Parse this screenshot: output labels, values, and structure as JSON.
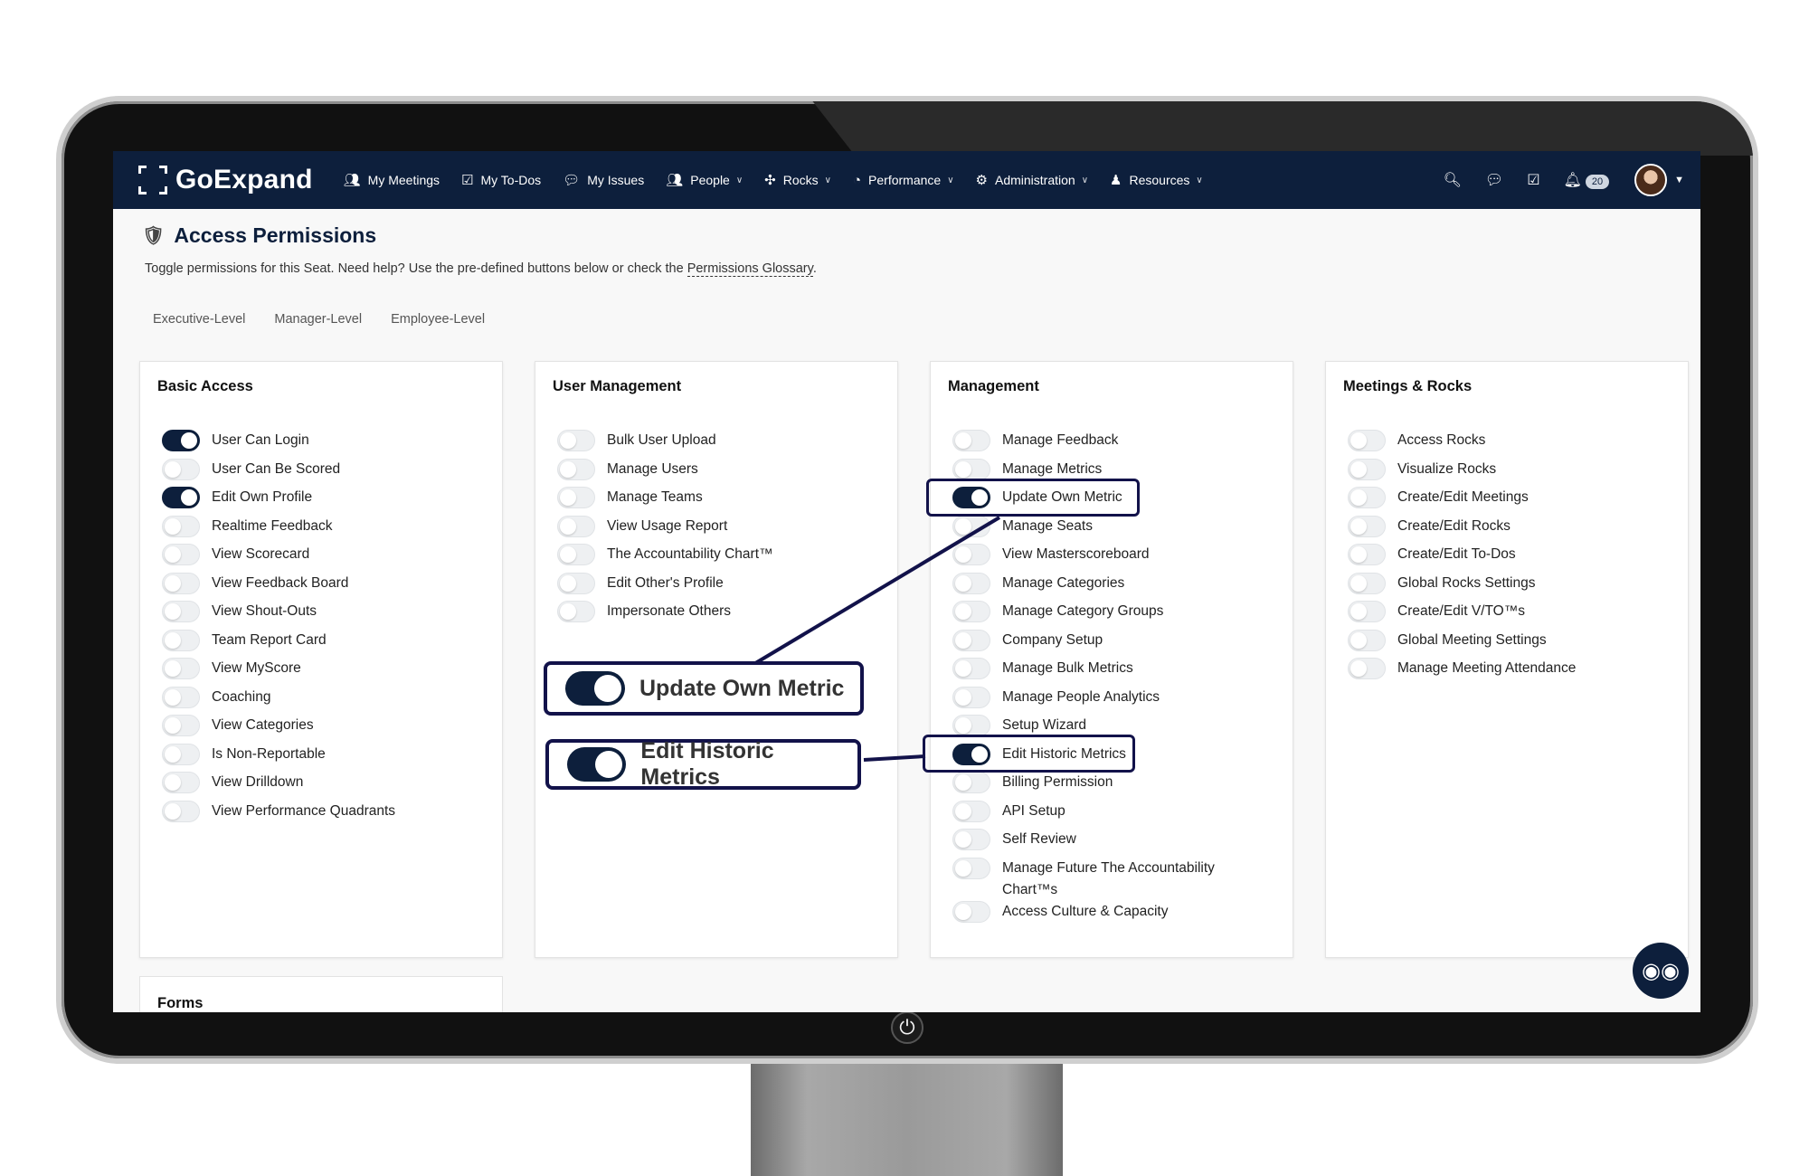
{
  "nav": {
    "logo": "GoExpand",
    "items": [
      {
        "label": "My Meetings",
        "icon": "meetings-icon",
        "dropdown": false
      },
      {
        "label": "My To-Dos",
        "icon": "checkbox-icon",
        "dropdown": false
      },
      {
        "label": "My Issues",
        "icon": "chat-icon",
        "dropdown": false
      },
      {
        "label": "People",
        "icon": "people-icon",
        "dropdown": true
      },
      {
        "label": "Rocks",
        "icon": "rocks-icon",
        "dropdown": true
      },
      {
        "label": "Performance",
        "icon": "gauge-icon",
        "dropdown": true
      },
      {
        "label": "Administration",
        "icon": "gear-icon",
        "dropdown": true
      },
      {
        "label": "Resources",
        "icon": "resources-icon",
        "dropdown": true
      }
    ],
    "notification_count": "20"
  },
  "page": {
    "title": "Access Permissions",
    "description_pre": "Toggle permissions for this Seat. Need help? Use the pre-defined buttons below or check the ",
    "glossary_link": "Permissions Glossary",
    "description_post": ".",
    "levels": [
      "Executive-Level",
      "Manager-Level",
      "Employee-Level"
    ]
  },
  "cards": [
    {
      "title": "Basic Access",
      "permissions": [
        {
          "label": "User Can Login",
          "on": true
        },
        {
          "label": "User Can Be Scored",
          "on": false
        },
        {
          "label": "Edit Own Profile",
          "on": true
        },
        {
          "label": "Realtime Feedback",
          "on": false
        },
        {
          "label": "View Scorecard",
          "on": false
        },
        {
          "label": "View Feedback Board",
          "on": false
        },
        {
          "label": "View Shout-Outs",
          "on": false
        },
        {
          "label": "Team Report Card",
          "on": false
        },
        {
          "label": "View MyScore",
          "on": false
        },
        {
          "label": "Coaching",
          "on": false
        },
        {
          "label": "View Categories",
          "on": false
        },
        {
          "label": "Is Non-Reportable",
          "on": false
        },
        {
          "label": "View Drilldown",
          "on": false
        },
        {
          "label": "View Performance Quadrants",
          "on": false
        }
      ]
    },
    {
      "title": "User Management",
      "permissions": [
        {
          "label": "Bulk User Upload",
          "on": false
        },
        {
          "label": "Manage Users",
          "on": false
        },
        {
          "label": "Manage Teams",
          "on": false
        },
        {
          "label": "View Usage Report",
          "on": false
        },
        {
          "label": "The Accountability Chart™",
          "on": false
        },
        {
          "label": "Edit Other's Profile",
          "on": false
        },
        {
          "label": "Impersonate Others",
          "on": false
        }
      ]
    },
    {
      "title": "Management",
      "permissions": [
        {
          "label": "Manage Feedback",
          "on": false
        },
        {
          "label": "Manage Metrics",
          "on": false
        },
        {
          "label": "Update Own Metric",
          "on": true
        },
        {
          "label": "Manage Seats",
          "on": false
        },
        {
          "label": "View Masterscoreboard",
          "on": false
        },
        {
          "label": "Manage Categories",
          "on": false
        },
        {
          "label": "Manage Category Groups",
          "on": false
        },
        {
          "label": "Company Setup",
          "on": false
        },
        {
          "label": "Manage Bulk Metrics",
          "on": false
        },
        {
          "label": "Manage People Analytics",
          "on": false
        },
        {
          "label": "Setup Wizard",
          "on": false
        },
        {
          "label": "Edit Historic Metrics",
          "on": true
        },
        {
          "label": "Billing Permission",
          "on": false
        },
        {
          "label": "API Setup",
          "on": false
        },
        {
          "label": "Self Review",
          "on": false
        },
        {
          "label": "Manage Future The Accountability Chart™s",
          "on": false
        },
        {
          "label": "Access Culture & Capacity",
          "on": false
        }
      ]
    },
    {
      "title": "Meetings & Rocks",
      "permissions": [
        {
          "label": "Access Rocks",
          "on": false
        },
        {
          "label": "Visualize Rocks",
          "on": false
        },
        {
          "label": "Create/Edit Meetings",
          "on": false
        },
        {
          "label": "Create/Edit Rocks",
          "on": false
        },
        {
          "label": "Create/Edit To-Dos",
          "on": false
        },
        {
          "label": "Global Rocks Settings",
          "on": false
        },
        {
          "label": "Create/Edit V/TO™s",
          "on": false
        },
        {
          "label": "Global Meeting Settings",
          "on": false
        },
        {
          "label": "Manage Meeting Attendance",
          "on": false
        }
      ]
    }
  ],
  "forms_card": {
    "title": "Forms"
  },
  "callouts": [
    {
      "label": "Update Own Metric"
    },
    {
      "label": "Edit Historic Metrics"
    }
  ],
  "colors": {
    "navy": "#0d1f3c",
    "callout_border": "#12124a"
  }
}
